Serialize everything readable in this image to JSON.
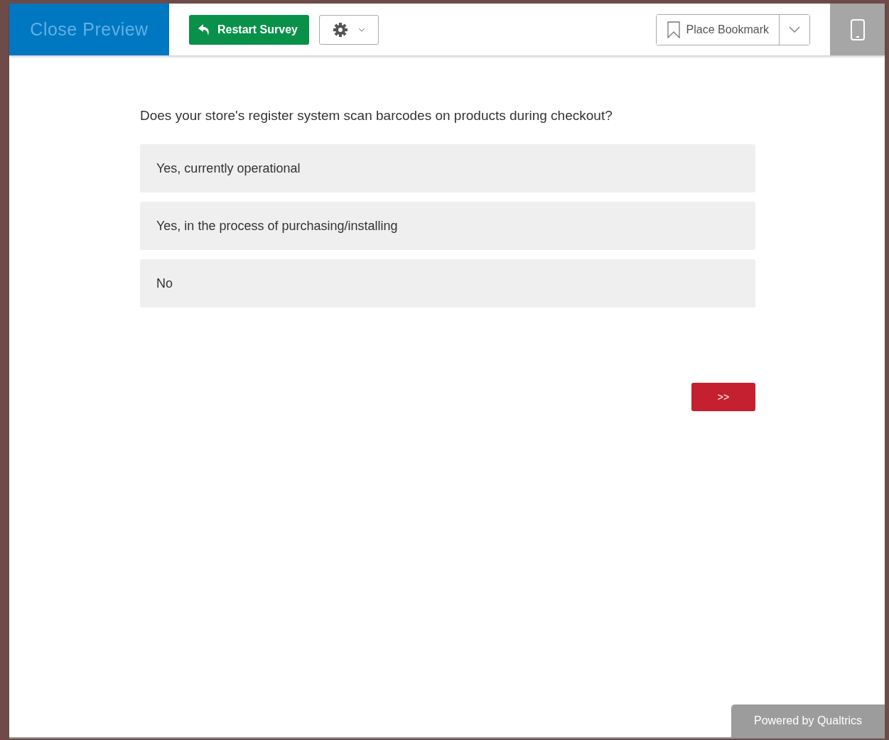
{
  "toolbar": {
    "close_preview": "Close Preview",
    "restart": "Restart Survey",
    "bookmark": "Place Bookmark"
  },
  "question": {
    "text": "Does your store's register system scan barcodes on products during checkout?",
    "options": [
      {
        "label": "Yes, currently operational"
      },
      {
        "label": "Yes, in the process of purchasing/installing"
      },
      {
        "label": "No"
      }
    ]
  },
  "next_button": ">>",
  "footer": "Powered by Qualtrics"
}
